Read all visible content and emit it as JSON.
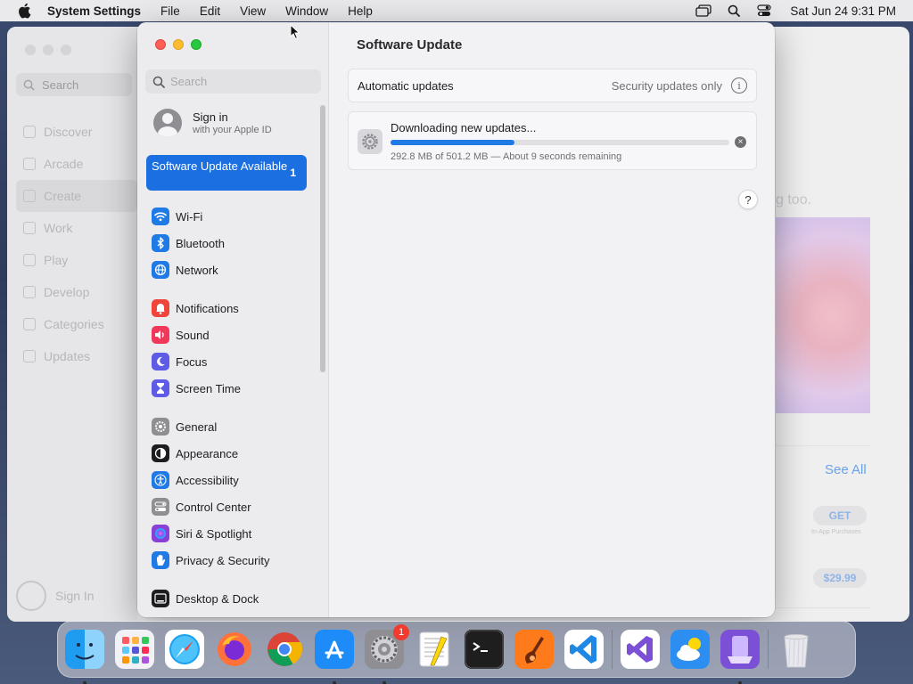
{
  "menubar": {
    "app_name": "System Settings",
    "menus": [
      "File",
      "Edit",
      "View",
      "Window",
      "Help"
    ],
    "clock": "Sat Jun 24  9:31 PM"
  },
  "background_app": {
    "search_placeholder": "Search",
    "nav": [
      "Discover",
      "Arcade",
      "Create",
      "Work",
      "Play",
      "Develop",
      "Categories",
      "Updates"
    ],
    "sign_in": "Sign In",
    "partial_text": "g too.",
    "see_all": "See All",
    "get_label": "GET",
    "in_app": "In-App Purchases",
    "price": "$29.99"
  },
  "settings": {
    "search_placeholder": "Search",
    "sign_in": {
      "title": "Sign in",
      "subtitle": "with your Apple ID"
    },
    "update_banner": {
      "label": "Software Update Available",
      "count": "1"
    },
    "nav_groups": [
      [
        {
          "label": "Wi-Fi",
          "icon": "wifi-icon",
          "color": "#1f7ae6"
        },
        {
          "label": "Bluetooth",
          "icon": "bluetooth-icon",
          "color": "#1f7ae6"
        },
        {
          "label": "Network",
          "icon": "globe-icon",
          "color": "#1f7ae6"
        }
      ],
      [
        {
          "label": "Notifications",
          "icon": "bell-icon",
          "color": "#f0453a"
        },
        {
          "label": "Sound",
          "icon": "speaker-icon",
          "color": "#f0385a"
        },
        {
          "label": "Focus",
          "icon": "moon-icon",
          "color": "#5e5ce6"
        },
        {
          "label": "Screen Time",
          "icon": "hourglass-icon",
          "color": "#5e5ce6"
        }
      ],
      [
        {
          "label": "General",
          "icon": "gear-icon",
          "color": "#8e8e93"
        },
        {
          "label": "Appearance",
          "icon": "appearance-icon",
          "color": "#1d1d1f"
        },
        {
          "label": "Accessibility",
          "icon": "accessibility-icon",
          "color": "#1f7ae6"
        },
        {
          "label": "Control Center",
          "icon": "control-center-icon",
          "color": "#8e8e93"
        },
        {
          "label": "Siri & Spotlight",
          "icon": "siri-icon",
          "color": "#8a3fd6"
        },
        {
          "label": "Privacy & Security",
          "icon": "hand-icon",
          "color": "#1f7ae6"
        }
      ],
      [
        {
          "label": "Desktop & Dock",
          "icon": "dock-icon",
          "color": "#1d1d1f"
        }
      ]
    ],
    "main": {
      "title": "Software Update",
      "automatic_updates": {
        "label": "Automatic updates",
        "value": "Security updates only"
      },
      "download": {
        "title": "Downloading new updates...",
        "progress": 0.366,
        "detail": "292.8 MB of 501.2 MB — About 9 seconds remaining"
      },
      "help_label": "?"
    }
  },
  "dock": {
    "apps": [
      {
        "name": "finder-app",
        "running": true
      },
      {
        "name": "launchpad-app",
        "running": false
      },
      {
        "name": "safari-app",
        "running": false
      },
      {
        "name": "firefox-app",
        "running": false
      },
      {
        "name": "chrome-app",
        "running": false
      },
      {
        "name": "app-store-app",
        "running": true
      },
      {
        "name": "system-settings-app",
        "running": true,
        "badge": "1"
      },
      {
        "name": "textedit-app",
        "running": false
      },
      {
        "name": "terminal-app",
        "running": false
      },
      {
        "name": "garageband-app",
        "running": false
      },
      {
        "name": "vscode-app",
        "running": false
      }
    ],
    "apps_right": [
      {
        "name": "visual-studio-app",
        "running": false
      },
      {
        "name": "weather-app",
        "running": false
      },
      {
        "name": "simulator-app",
        "running": true
      }
    ]
  }
}
